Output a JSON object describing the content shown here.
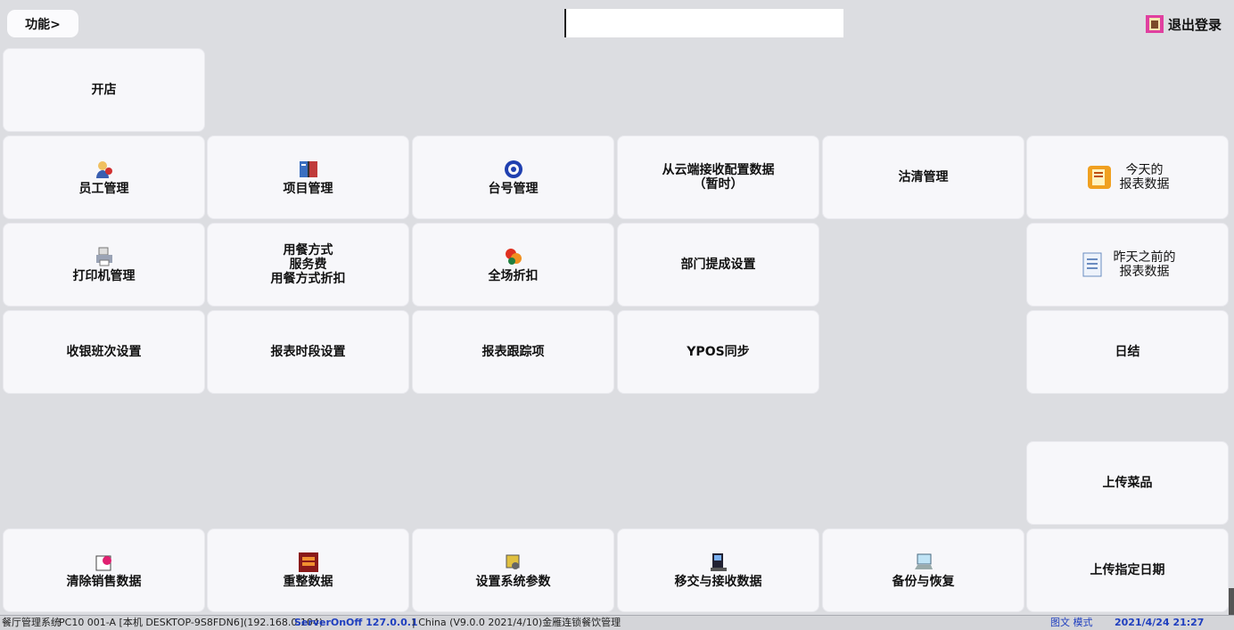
{
  "header": {
    "function_label": "功能>",
    "search_value": "",
    "logout_label": "退出登录"
  },
  "tiles": {
    "open_store": "开店",
    "staff": "员工管理",
    "items": "项目管理",
    "tables": "台号管理",
    "cloud_receive_line1": "从云端接收配置数据",
    "cloud_receive_line2": "（暂时）",
    "estimate": "沽清管理",
    "today_report_line1": "今天的",
    "today_report_line2": "报表数据",
    "printer": "打印机管理",
    "dining_line1": "用餐方式",
    "dining_line2": "服务费",
    "dining_line3": "用餐方式折扣",
    "full_discount": "全场折扣",
    "dept_commission": "部门提成设置",
    "previous_report_line1": "昨天之前的",
    "previous_report_line2": "报表数据",
    "cashier_shift": "收银班次设置",
    "report_period": "报表时段设置",
    "report_tracking": "报表跟踪项",
    "ypos_sync": "YPOS同步",
    "daily_close": "日结",
    "upload_dishes": "上传菜品",
    "clear_sales": "清除销售数据",
    "rebuild": "重整数据",
    "system_params": "设置系统参数",
    "transfer_receive": "移交与接收数据",
    "backup_restore": "备份与恢复",
    "upload_date": "上传指定日期"
  },
  "status": {
    "s1": "餐厅管理系统",
    "s2": "PC10 001-A [本机 DESKTOP-9S8FDN6](192.168.0.104)",
    "s3": "ServerOnOff 127.0.0.1",
    "s4": "| China (V9.0.0 2021/4/10)金雁连锁餐饮管理",
    "s5": "图文 模式",
    "s6": "2021/4/24 21:27"
  },
  "colors": {
    "background": "#dcdde1",
    "tile": "#f7f7fa",
    "status_link": "#1f3fbf"
  }
}
